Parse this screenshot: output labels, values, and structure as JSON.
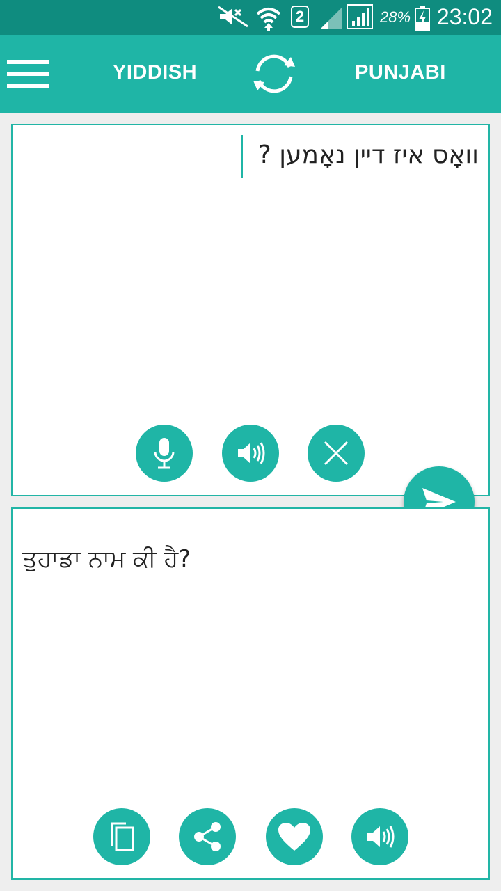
{
  "status_bar": {
    "sim_slot": "2",
    "battery_percent": "28%",
    "time": "23:02",
    "icons": [
      "mute-icon",
      "wifi-icon",
      "sim-2-icon",
      "signal-weak-icon",
      "signal-full-icon",
      "battery-charging-icon"
    ]
  },
  "app_bar": {
    "source_language": "YIDDISH",
    "target_language": "PUNJABI",
    "icons": {
      "menu": "hamburger-menu-icon",
      "swap": "swap-languages-icon"
    }
  },
  "source_panel": {
    "input_text": "וואָס איז דיין נאָמען ?",
    "buttons": [
      "microphone-icon",
      "speaker-icon",
      "close-icon"
    ]
  },
  "target_panel": {
    "output_text": "ਤੁਹਾਡਾ ਨਾਮ ਕੀ ਹੈ?",
    "buttons": [
      "copy-icon",
      "share-icon",
      "heart-icon",
      "speaker-icon"
    ]
  },
  "send_button": {
    "icon": "send-icon"
  },
  "colors": {
    "status_bar": "#0f8c7f",
    "accent": "#1fb5a6",
    "background": "#eeeeee",
    "panel": "#ffffff"
  }
}
